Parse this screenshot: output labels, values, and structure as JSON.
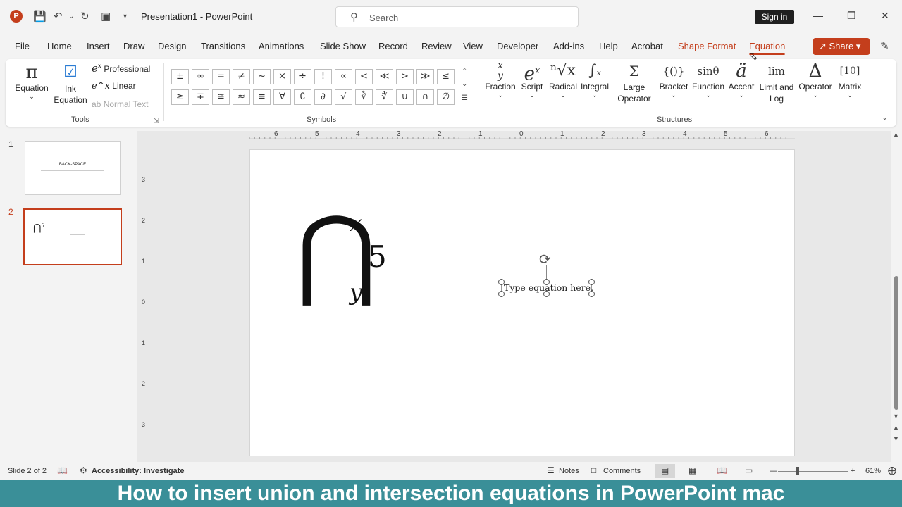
{
  "titlebar": {
    "doc_title": "Presentation1  -  PowerPoint",
    "search_placeholder": "Search",
    "sign_in": "Sign in"
  },
  "tabs": [
    "File",
    "Home",
    "Insert",
    "Draw",
    "Design",
    "Transitions",
    "Animations",
    "Slide Show",
    "Record",
    "Review",
    "View",
    "Developer",
    "Add-ins",
    "Help",
    "Acrobat",
    "Shape Format",
    "Equation"
  ],
  "share_label": "Share",
  "ribbon": {
    "tools": {
      "equation": "Equation",
      "ink_equation": "Ink Equation",
      "professional": "Professional",
      "linear": "Linear",
      "normal_text": "Normal Text",
      "group_label": "Tools"
    },
    "symbols": {
      "items": [
        "±",
        "∞",
        "=",
        "≠",
        "~",
        "×",
        "÷",
        "!",
        "∝",
        "<",
        "≪",
        ">",
        "≫",
        "≤",
        "≥",
        "∓",
        "≅",
        "≈",
        "≡",
        "∀",
        "∁",
        "∂",
        "√",
        "∛",
        "∜",
        "∪",
        "∩",
        "∅"
      ],
      "group_label": "Symbols"
    },
    "structures": {
      "items": [
        {
          "label": "Fraction",
          "glyph": "x/y"
        },
        {
          "label": "Script",
          "glyph": "eˣ"
        },
        {
          "label": "Radical",
          "glyph": "ⁿ√x"
        },
        {
          "label": "Integral",
          "glyph": "∫"
        },
        {
          "label": "Large Operator",
          "glyph": "Σ"
        },
        {
          "label": "Bracket",
          "glyph": "{()}"
        },
        {
          "label": "Function",
          "glyph": "sinθ"
        },
        {
          "label": "Accent",
          "glyph": "ä"
        },
        {
          "label": "Limit and Log",
          "glyph": "lim"
        },
        {
          "label": "Operator",
          "glyph": "Δ"
        },
        {
          "label": "Matrix",
          "glyph": "[10]"
        }
      ],
      "group_label": "Structures"
    }
  },
  "slides_pane": {
    "slide1_num": "1",
    "slide1_title": "BACK-SPACE",
    "slide2_num": "2"
  },
  "slide": {
    "operator": "⋂",
    "superscript": "x",
    "subscript": "y",
    "operand": "5",
    "eq_placeholder": "Type equation here."
  },
  "ruler": {
    "h_ticks": [
      "6",
      "5",
      "4",
      "3",
      "2",
      "1",
      "0",
      "1",
      "2",
      "3",
      "4",
      "5",
      "6"
    ],
    "v_ticks": [
      "3",
      "2",
      "1",
      "0",
      "1",
      "2",
      "3"
    ]
  },
  "statusbar": {
    "slide_info": "Slide 2 of 2",
    "accessibility": "Accessibility: Investigate",
    "notes": "Notes",
    "comments": "Comments",
    "zoom": "61%"
  },
  "banner": "How to insert union and intersection equations in PowerPoint mac",
  "colors": {
    "accent": "#c43e1c",
    "banner": "#3a8f98"
  }
}
